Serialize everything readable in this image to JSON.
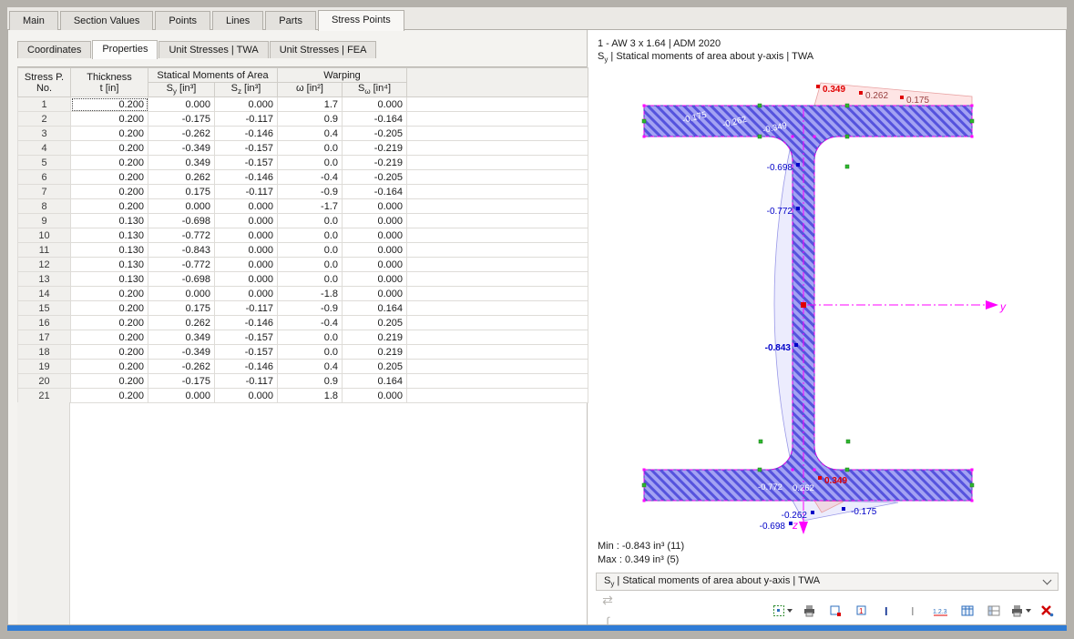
{
  "colors": {
    "section_light": "#a3a2f3",
    "section_dark": "#5553dd",
    "outline": "#ee00ee",
    "axis": "#ff00ff",
    "green": "#2db82d",
    "blue": "#0000c8",
    "red": "#e00000",
    "darkred": "#994040",
    "accent": "#2f7cd6"
  },
  "main_tabs": [
    {
      "label": "Main"
    },
    {
      "label": "Section Values"
    },
    {
      "label": "Points"
    },
    {
      "label": "Lines"
    },
    {
      "label": "Parts"
    },
    {
      "label": "Stress Points",
      "active": true
    }
  ],
  "sub_tabs": [
    {
      "label": "Coordinates"
    },
    {
      "label": "Properties",
      "active": true
    },
    {
      "label": "Unit Stresses | TWA"
    },
    {
      "label": "Unit Stresses | FEA"
    }
  ],
  "table": {
    "headers": {
      "no1": "Stress P.",
      "no2": "No.",
      "t1": "Thickness",
      "t2": "t [in]",
      "group_statical": "Statical Moments of Area",
      "group_warping": "Warping",
      "sy": {
        "base": "S",
        "sub": "y",
        "unit": " [in³]"
      },
      "sz": {
        "base": "S",
        "sub": "z",
        "unit": " [in³]"
      },
      "omega": {
        "base": "ω",
        "sub": "",
        "unit": " [in²]"
      },
      "somega": {
        "base": "S",
        "sub": "ω",
        "unit": " [in⁴]"
      }
    },
    "rows": [
      {
        "no": "1",
        "t": "0.200",
        "sy": "0.000",
        "sz": "0.000",
        "w": "1.7",
        "sw": "0.000"
      },
      {
        "no": "2",
        "t": "0.200",
        "sy": "-0.175",
        "sz": "-0.117",
        "w": "0.9",
        "sw": "-0.164"
      },
      {
        "no": "3",
        "t": "0.200",
        "sy": "-0.262",
        "sz": "-0.146",
        "w": "0.4",
        "sw": "-0.205"
      },
      {
        "no": "4",
        "t": "0.200",
        "sy": "-0.349",
        "sz": "-0.157",
        "w": "0.0",
        "sw": "-0.219"
      },
      {
        "no": "5",
        "t": "0.200",
        "sy": "0.349",
        "sz": "-0.157",
        "w": "0.0",
        "sw": "-0.219"
      },
      {
        "no": "6",
        "t": "0.200",
        "sy": "0.262",
        "sz": "-0.146",
        "w": "-0.4",
        "sw": "-0.205"
      },
      {
        "no": "7",
        "t": "0.200",
        "sy": "0.175",
        "sz": "-0.117",
        "w": "-0.9",
        "sw": "-0.164"
      },
      {
        "no": "8",
        "t": "0.200",
        "sy": "0.000",
        "sz": "0.000",
        "w": "-1.7",
        "sw": "0.000"
      },
      {
        "no": "9",
        "t": "0.130",
        "sy": "-0.698",
        "sz": "0.000",
        "w": "0.0",
        "sw": "0.000"
      },
      {
        "no": "10",
        "t": "0.130",
        "sy": "-0.772",
        "sz": "0.000",
        "w": "0.0",
        "sw": "0.000"
      },
      {
        "no": "11",
        "t": "0.130",
        "sy": "-0.843",
        "sz": "0.000",
        "w": "0.0",
        "sw": "0.000"
      },
      {
        "no": "12",
        "t": "0.130",
        "sy": "-0.772",
        "sz": "0.000",
        "w": "0.0",
        "sw": "0.000"
      },
      {
        "no": "13",
        "t": "0.130",
        "sy": "-0.698",
        "sz": "0.000",
        "w": "0.0",
        "sw": "0.000"
      },
      {
        "no": "14",
        "t": "0.200",
        "sy": "0.000",
        "sz": "0.000",
        "w": "-1.8",
        "sw": "0.000"
      },
      {
        "no": "15",
        "t": "0.200",
        "sy": "0.175",
        "sz": "-0.117",
        "w": "-0.9",
        "sw": "0.164"
      },
      {
        "no": "16",
        "t": "0.200",
        "sy": "0.262",
        "sz": "-0.146",
        "w": "-0.4",
        "sw": "0.205"
      },
      {
        "no": "17",
        "t": "0.200",
        "sy": "0.349",
        "sz": "-0.157",
        "w": "0.0",
        "sw": "0.219"
      },
      {
        "no": "18",
        "t": "0.200",
        "sy": "-0.349",
        "sz": "-0.157",
        "w": "0.0",
        "sw": "0.219"
      },
      {
        "no": "19",
        "t": "0.200",
        "sy": "-0.262",
        "sz": "-0.146",
        "w": "0.4",
        "sw": "0.205"
      },
      {
        "no": "20",
        "t": "0.200",
        "sy": "-0.175",
        "sz": "-0.117",
        "w": "0.9",
        "sw": "0.164"
      },
      {
        "no": "21",
        "t": "0.200",
        "sy": "0.000",
        "sz": "0.000",
        "w": "1.8",
        "sw": "0.000"
      }
    ]
  },
  "viewer": {
    "title": "1 - AW 3 x 1.64 | ADM 2020",
    "subtitle": {
      "base": "S",
      "sub": "y",
      "rest": " | Statical moments of area about y-axis | TWA"
    },
    "min": "Min : -0.843 in³ (11)",
    "max": "Max : 0.349 in³ (5)",
    "selector": {
      "base": "S",
      "sub": "y",
      "rest": " | Statical moments of area about y-axis | TWA"
    },
    "axes": {
      "y": "y",
      "z": "z"
    },
    "labels": {
      "top": [
        "0.349",
        "0.262",
        "0.175"
      ],
      "top_flange": [
        "-0.175",
        "-0.262",
        "-0.349"
      ],
      "web": [
        "-0.698",
        "-0.772",
        "-0.843"
      ],
      "bottom_flange": [
        "-0.772",
        "0.262",
        "0.349"
      ],
      "bottom": [
        "-0.262",
        "-0.175",
        "-0.698"
      ]
    }
  },
  "toolbar": {
    "icons": [
      "sync-icon",
      "integral-icon",
      "marquee-select-icon",
      "printer-icon",
      "stress-points-icon",
      "stress-point-numbers-icon",
      "i-section-blue-icon",
      "i-section-gray-icon",
      "numbering-123-icon",
      "table-blue-icon",
      "table-gray-icon",
      "printer-caret-icon",
      "red-x-icon"
    ]
  }
}
